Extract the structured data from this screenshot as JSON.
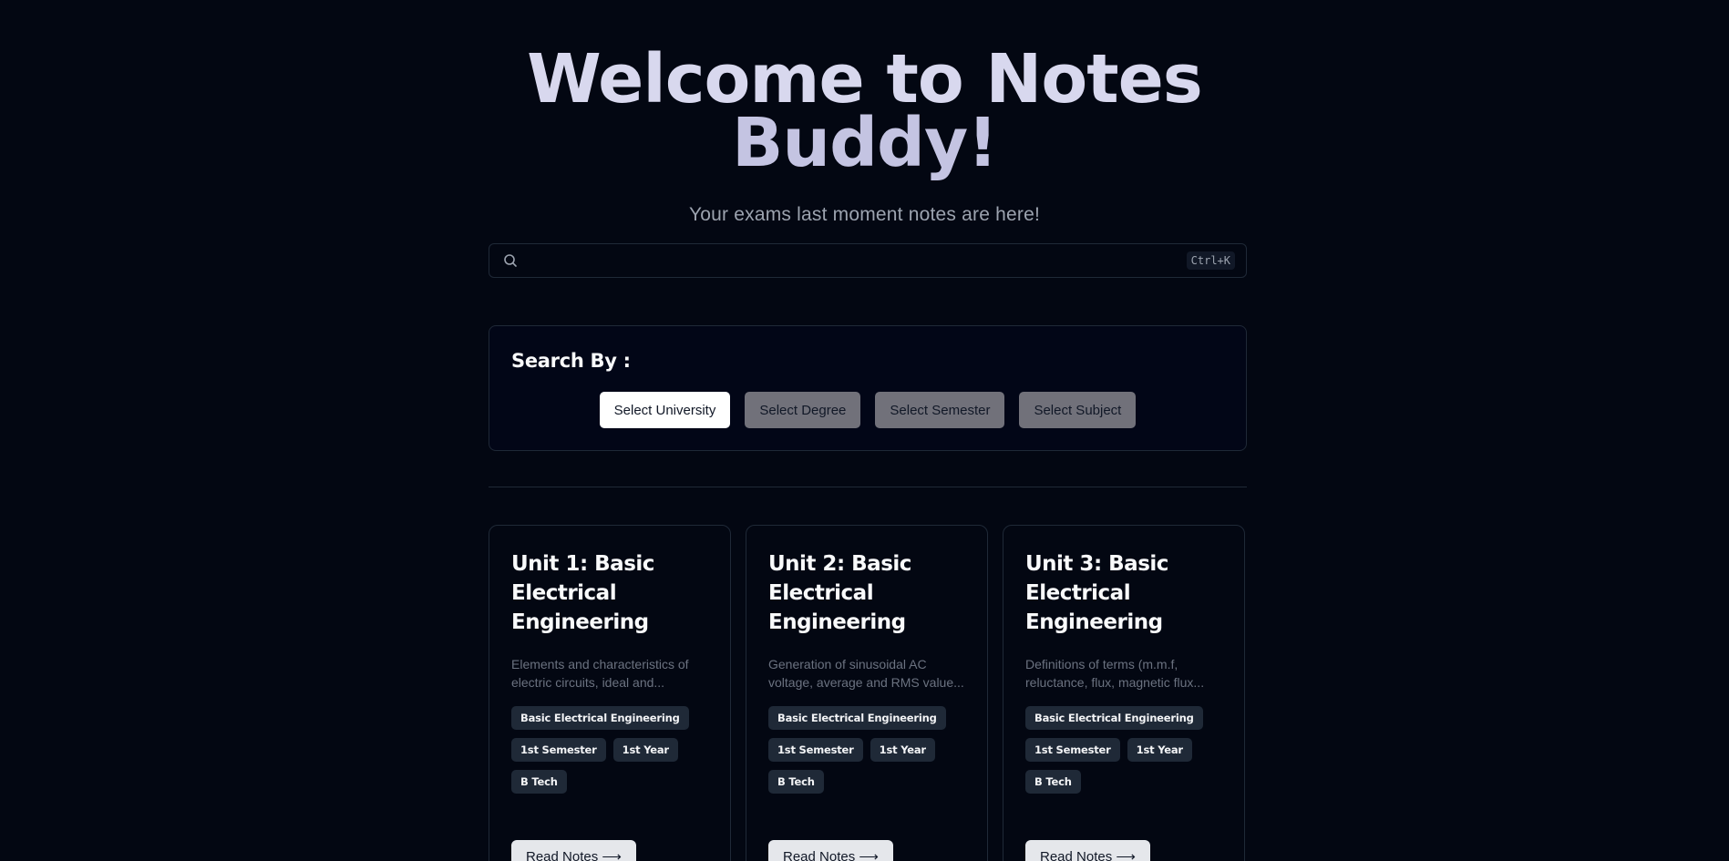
{
  "hero": {
    "title_line1": "Welcome to Notes",
    "title_line2": "Buddy!",
    "subtitle": "Your exams last moment notes are here!"
  },
  "search": {
    "placeholder": "",
    "value": "",
    "shortcut": "Ctrl+K",
    "icon": "search-icon"
  },
  "filters": {
    "title": "Search By :",
    "buttons": [
      {
        "label": "Select University",
        "active": true
      },
      {
        "label": "Select Degree",
        "active": false
      },
      {
        "label": "Select Semester",
        "active": false
      },
      {
        "label": "Select Subject",
        "active": false
      }
    ]
  },
  "cards": [
    {
      "title": "Unit 1: Basic Electrical Engineering",
      "description": "Elements and characteristics of electric circuits, ideal and...",
      "tags": [
        "Basic Electrical Engineering",
        "1st Semester",
        "1st Year",
        "B Tech"
      ],
      "button": "Read Notes ⟶"
    },
    {
      "title": "Unit 2: Basic Electrical Engineering",
      "description": "Generation of sinusoidal AC voltage, average and RMS value...",
      "tags": [
        "Basic Electrical Engineering",
        "1st Semester",
        "1st Year",
        "B Tech"
      ],
      "button": "Read Notes ⟶"
    },
    {
      "title": "Unit 3: Basic Electrical Engineering",
      "description": "Definitions of terms (m.m.f, reluctance, flux, magnetic flux...",
      "tags": [
        "Basic Electrical Engineering",
        "1st Semester",
        "1st Year",
        "B Tech"
      ],
      "button": "Read Notes ⟶"
    }
  ],
  "colors": {
    "background": "#030712",
    "border": "#1f2937",
    "title": "#d8d8ee",
    "tag_bg": "#1f2937",
    "button_inactive": "#71717a",
    "button_active": "#ffffff"
  }
}
